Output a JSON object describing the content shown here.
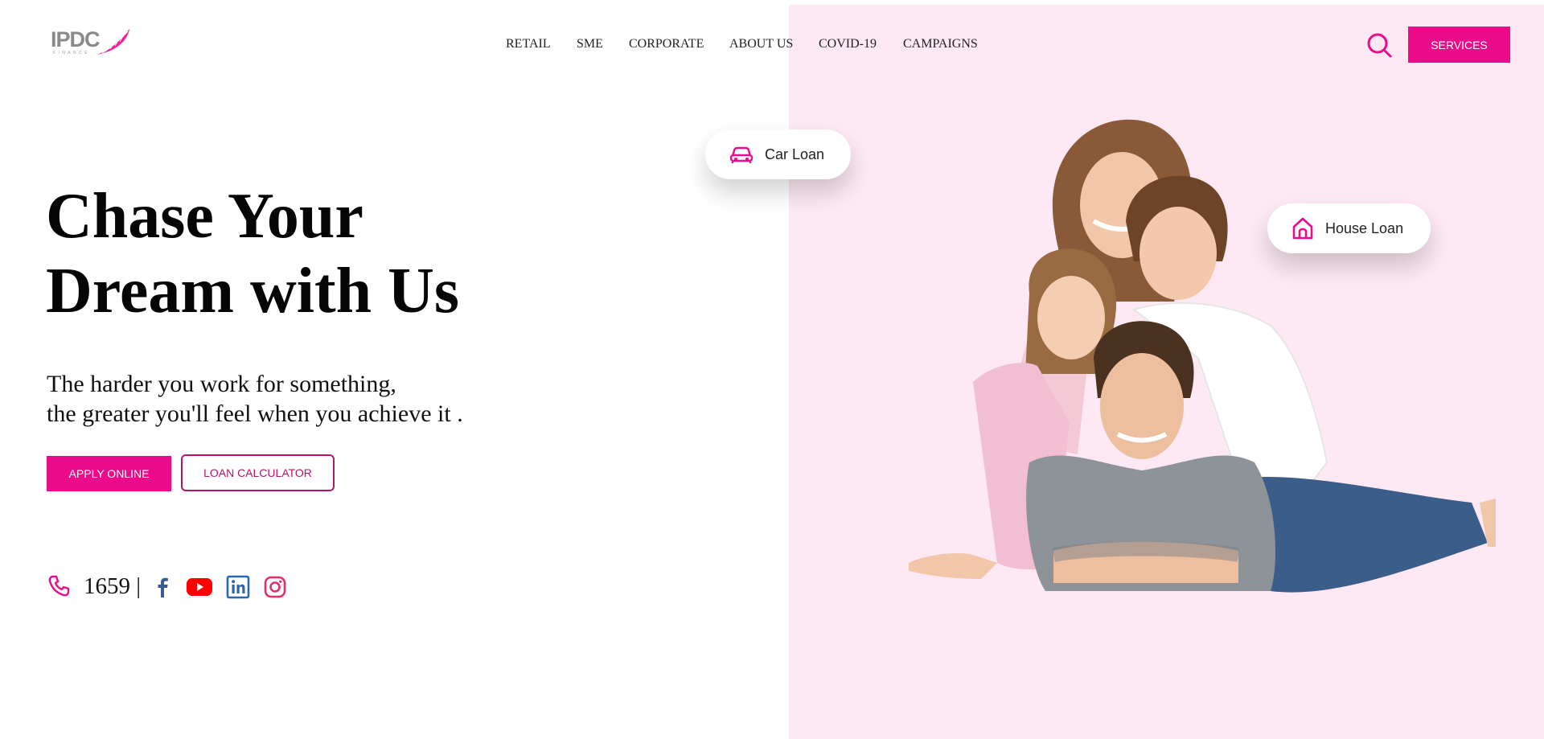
{
  "brand": {
    "logo_text": "IPDC",
    "logo_subtext": "FINANCE",
    "accent": "#eb0b8b",
    "panel_bg": "#fde8f3"
  },
  "nav": {
    "items": [
      {
        "label": "RETAIL"
      },
      {
        "label": "SME"
      },
      {
        "label": "CORPORATE"
      },
      {
        "label": "ABOUT US"
      },
      {
        "label": "COVID-19"
      },
      {
        "label": "CAMPAIGNS"
      }
    ],
    "search_icon": "search-icon",
    "services_label": "SERVICES"
  },
  "hero": {
    "title_line1": "Chase Your",
    "title_line2": "Dream with Us",
    "subtitle_line1": "The harder you work for something,",
    "subtitle_line2": "the greater you'll feel when you achieve it .",
    "apply_label": "APPLY ONLINE",
    "calculator_label": "LOAN CALCULATOR"
  },
  "contact": {
    "phone_icon": "phone-icon",
    "hotline": "1659 |",
    "social": [
      "facebook-icon",
      "youtube-icon",
      "linkedin-icon",
      "instagram-icon"
    ]
  },
  "chips": {
    "car_loan": "Car Loan",
    "house_loan": "House Loan"
  }
}
